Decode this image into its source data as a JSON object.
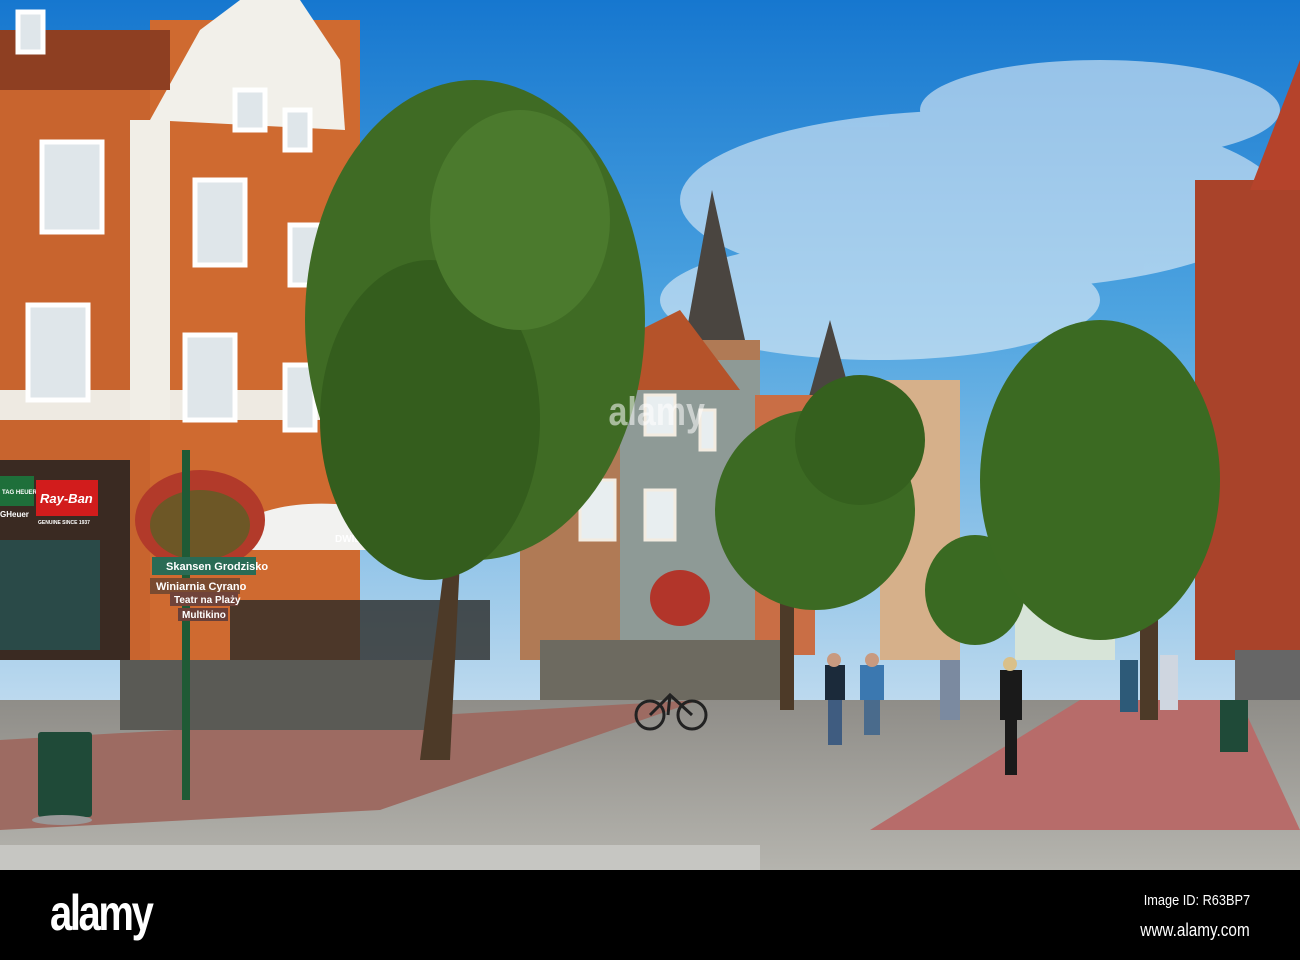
{
  "scene": {
    "signs": {
      "ray_ban": "Ray-Ban",
      "ray_ban_sub": "GENUINE SINCE 1937",
      "tag_heuer": "TAG HEUER",
      "tag_heuer_text": "GHeuer",
      "umbrella": "DWIE ZMIANY",
      "direction_1": "Skansen Grodzisko",
      "direction_2": "Winiarnia Cyrano",
      "direction_3": "Teatr na Plaży",
      "direction_4": "Multikino"
    },
    "watermark": "alamy"
  },
  "footer": {
    "logo": "alamy",
    "image_id": "Image ID: R63BP7",
    "url": "www.alamy.com"
  },
  "colors": {
    "sky": "#1f8ad8",
    "brick": "#c8642e",
    "foliage": "#3f6b24",
    "pavement": "#a9a9a2",
    "footer": "#000000"
  }
}
